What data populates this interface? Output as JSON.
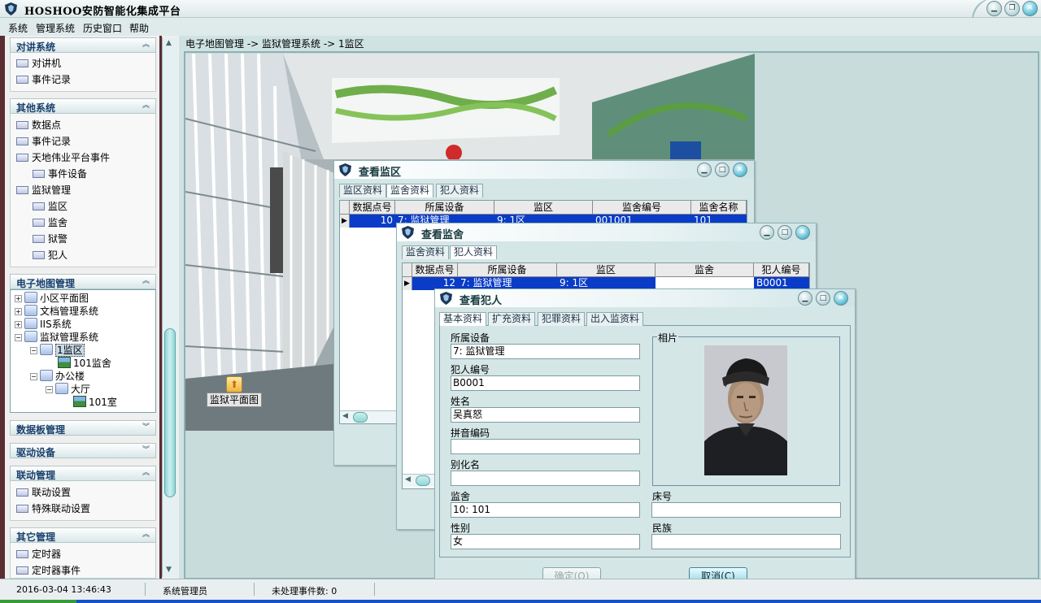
{
  "app": {
    "title": "HOSHOO安防智能化集成平台",
    "accent": "#1a3f6c",
    "frame_border": "#5a2d32"
  },
  "window_buttons": {
    "minimize": "minimize-icon",
    "restore": "restore-icon",
    "close": "close-icon"
  },
  "menu": [
    "系统",
    "管理系统",
    "历史窗口",
    "帮助"
  ],
  "sidebar": {
    "groups": [
      {
        "title": "对讲系统",
        "items": [
          "对讲机",
          "事件记录"
        ]
      },
      {
        "title": "其他系统",
        "items": [
          "数据点",
          "事件记录",
          "天地伟业平台事件",
          "事件设备",
          "监狱管理",
          "监区",
          "监舍",
          "狱警",
          "犯人"
        ]
      },
      {
        "title": "电子地图管理"
      },
      {
        "title": "数据板管理"
      },
      {
        "title": "驱动设备"
      },
      {
        "title": "联动管理",
        "items": [
          "联动设置",
          "特殊联动设置"
        ]
      },
      {
        "title": "其它管理",
        "items": [
          "定时器",
          "定时器事件"
        ]
      }
    ],
    "tree": [
      "小区平面图",
      "文档管理系统",
      "IIS系统",
      "监狱管理系统",
      "1监区",
      "101监舍",
      "办公楼",
      "大厅",
      "101室"
    ]
  },
  "breadcrumb": "电子地图管理 -> 监狱管理系统 -> 1监区",
  "map": {
    "marker_label": "监狱平面图"
  },
  "dialog_zone": {
    "title": "查看监区",
    "tabs": [
      "监区资料",
      "监舍资料",
      "犯人资料"
    ],
    "active_tab": "监舍资料",
    "columns": [
      "数据点号",
      "所属设备",
      "监区",
      "监舍编号",
      "监舍名称"
    ],
    "row": [
      "10",
      "7: 监狱管理",
      "9: 1区",
      "001001",
      "101"
    ]
  },
  "dialog_cell": {
    "title": "查看监舍",
    "tabs": [
      "监舍资料",
      "犯人资料"
    ],
    "active_tab": "犯人资料",
    "columns": [
      "数据点号",
      "所属设备",
      "监区",
      "监舍",
      "犯人编号"
    ],
    "row": [
      "12",
      "7: 监狱管理",
      "9: 1区",
      "",
      "B0001"
    ]
  },
  "dialog_prisoner": {
    "title": "查看犯人",
    "tabs": [
      "基本资料",
      "扩充资料",
      "犯罪资料",
      "出入监资料"
    ],
    "fields": {
      "device_label": "所属设备",
      "device_value": "7: 监狱管理",
      "id_label": "犯人编号",
      "id_value": "B0001",
      "name_label": "姓名",
      "name_value": "吴真怒",
      "pinyin_label": "拼音编码",
      "pinyin_value": "",
      "alias_label": "别化名",
      "alias_value": "",
      "cell_label": "监舍",
      "cell_value": "10: 101",
      "gender_label": "性别",
      "gender_value": "女",
      "bed_label": "床号",
      "bed_value": "",
      "ethnic_label": "民族",
      "ethnic_value": ""
    },
    "photo_label": "相片",
    "ok_label": "确定(O)",
    "cancel_label": "取消(C)"
  },
  "status": {
    "datetime": "2016-03-04 13:46:43",
    "user": "系统管理员",
    "pending": "未处理事件数: 0"
  }
}
